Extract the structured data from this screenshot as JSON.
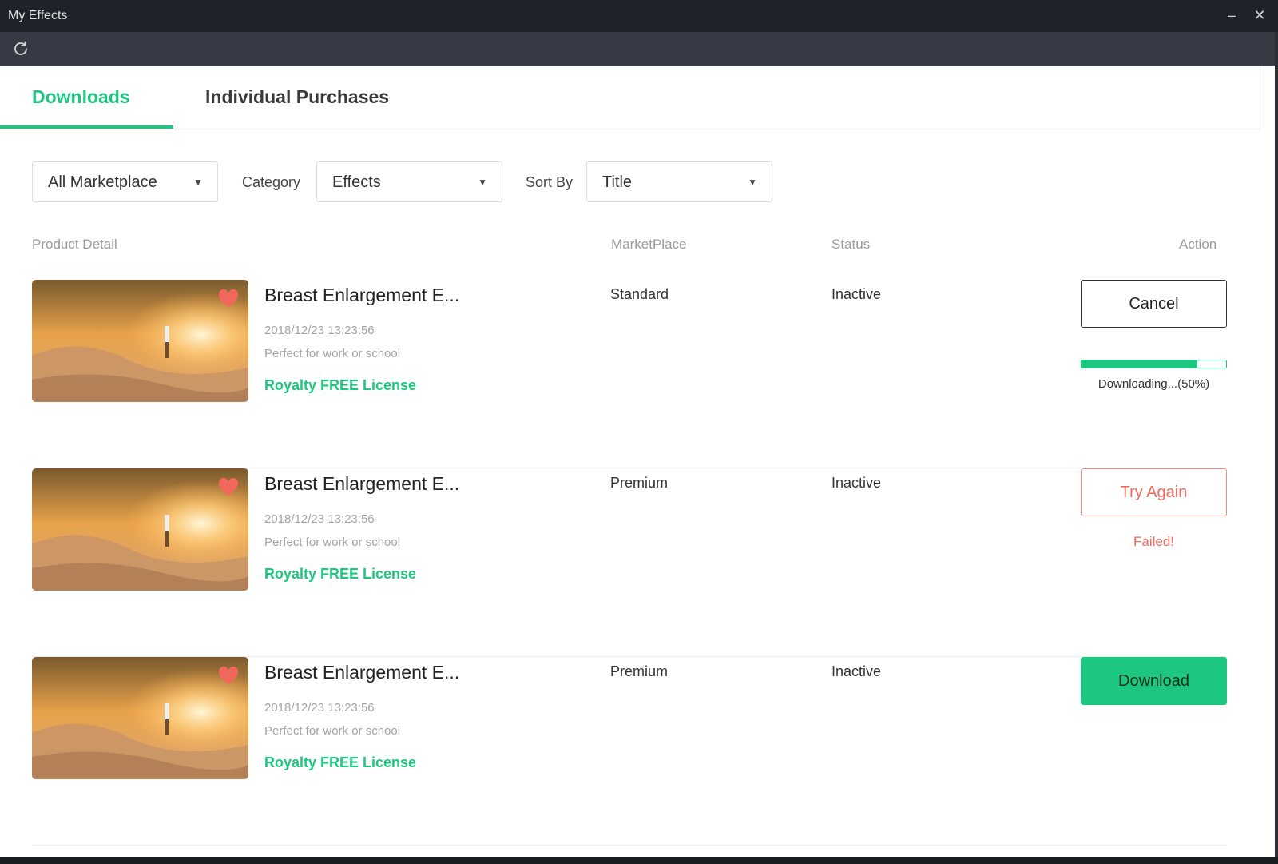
{
  "window": {
    "title": "My Effects",
    "minimize_glyph": "–",
    "close_glyph": "✕"
  },
  "toolbar": {
    "refresh_icon": "refresh-icon"
  },
  "tabs": [
    {
      "label": "Downloads",
      "active": true
    },
    {
      "label": "Individual Purchases",
      "active": false
    }
  ],
  "filters": {
    "marketplace": {
      "value": "All Marketplace"
    },
    "category": {
      "label": "Category",
      "value": "Effects"
    },
    "sort": {
      "label": "Sort By",
      "value": "Title"
    }
  },
  "columns": {
    "product": "Product Detail",
    "marketplace": "MarketPlace",
    "status": "Status",
    "action": "Action"
  },
  "items": [
    {
      "name": "Breast Enlargement E...",
      "date": "2018/12/23 13:23:56",
      "description": "Perfect for work or school",
      "license": "Royalty FREE License",
      "marketplace": "Standard",
      "status": "Inactive",
      "action_label": "Cancel",
      "progress": 0.8,
      "progress_text": "Downloading...(50%)"
    },
    {
      "name": "Breast Enlargement E...",
      "date": "2018/12/23 13:23:56",
      "description": "Perfect for work or school",
      "license": "Royalty FREE License",
      "marketplace": "Premium",
      "status": "Inactive",
      "action_label": "Try Again",
      "note": "Failed!"
    },
    {
      "name": "Breast Enlargement E...",
      "date": "2018/12/23 13:23:56",
      "description": "Perfect for work or school",
      "license": "Royalty FREE License",
      "marketplace": "Premium",
      "status": "Inactive",
      "action_label": "Download"
    }
  ],
  "colors": {
    "accent": "#1ec77f",
    "error": "#ee6a5f",
    "heart": "#f2675c"
  }
}
